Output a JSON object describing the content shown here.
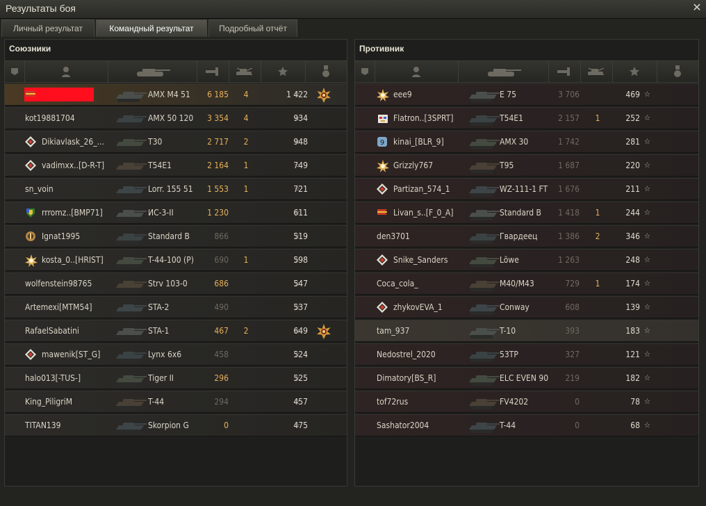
{
  "window": {
    "title": "Результаты боя",
    "close": "✕"
  },
  "tabs": [
    {
      "label": "Личный результат"
    },
    {
      "label": "Командный результат",
      "active": true
    },
    {
      "label": "Подробный отчёт"
    }
  ],
  "allies": {
    "title": "Союзники",
    "rows": [
      {
        "player": "",
        "vehicle": "AMX M4 51",
        "damage": "6 185",
        "kills": "4",
        "xp": "1 422",
        "star": "☆",
        "badge": "flag",
        "medal": true,
        "me": true
      },
      {
        "player": "kot19881704",
        "vehicle": "AMX 50 120",
        "damage": "3 354",
        "kills": "4",
        "xp": "934",
        "star": "☆"
      },
      {
        "player": "Dikiavlask_26_...",
        "vehicle": "T30",
        "damage": "2 717",
        "kills": "2",
        "xp": "948",
        "star": "☆",
        "badge": "diamond"
      },
      {
        "player": "vadimxx..[D-R-T]",
        "vehicle": "T54E1",
        "damage": "2 164",
        "kills": "1",
        "xp": "749",
        "star": "☆",
        "badge": "diamond"
      },
      {
        "player": "sn_voin",
        "vehicle": "Lorr. 155 51",
        "damage": "1 553",
        "kills": "1",
        "xp": "721",
        "star": "☆"
      },
      {
        "player": "rrromz..[BMP71]",
        "vehicle": "ИС-3-II",
        "damage": "1 230",
        "kills": "",
        "xp": "611",
        "star": "☆",
        "badge": "shield"
      },
      {
        "player": "Ignat1995",
        "vehicle": "Standard B",
        "damage": "866",
        "kills": "",
        "xp": "519",
        "star": "☆",
        "badge": "round",
        "dead": true,
        "gray": true
      },
      {
        "player": "kosta_0..[HRIST]",
        "vehicle": "T-44-100 (P)",
        "damage": "690",
        "kills": "1",
        "xp": "598",
        "star": "☆",
        "badge": "sun",
        "dead": true,
        "gray": true
      },
      {
        "player": "wolfenstein98765",
        "vehicle": "Strv 103-0",
        "damage": "686",
        "kills": "",
        "xp": "547",
        "star": "☆"
      },
      {
        "player": "Artemexi[MTM54]",
        "vehicle": "STA-2",
        "damage": "490",
        "kills": "",
        "xp": "537",
        "star": "☆",
        "dead": true,
        "gray": true
      },
      {
        "player": "RafaelSabatini",
        "vehicle": "STA-1",
        "damage": "467",
        "kills": "2",
        "xp": "649",
        "star": "☆",
        "medal": true
      },
      {
        "player": "mawenik[ST_G]",
        "vehicle": "Lynx 6x6",
        "damage": "458",
        "kills": "",
        "xp": "524",
        "star": "☆",
        "badge": "diamond",
        "dead": true,
        "gray": true
      },
      {
        "player": "halo013[-TUS-]",
        "vehicle": "Tiger II",
        "damage": "296",
        "kills": "",
        "xp": "525",
        "star": "☆"
      },
      {
        "player": "King_PiligriM",
        "vehicle": "T-44",
        "damage": "294",
        "kills": "",
        "xp": "457",
        "star": "☆",
        "dead": true,
        "gray": true
      },
      {
        "player": "TITAN139",
        "vehicle": "Skorpion G",
        "damage": "0",
        "kills": "",
        "xp": "475",
        "star": "☆"
      }
    ]
  },
  "enemies": {
    "title": "Противник",
    "rows": [
      {
        "player": "eee9",
        "vehicle": "E 75",
        "damage": "3 706",
        "kills": "",
        "xp": "469",
        "star": "☆",
        "badge": "sun"
      },
      {
        "player": "Flatron..[3SPRT]",
        "vehicle": "T54E1",
        "damage": "2 157",
        "kills": "1",
        "xp": "252",
        "star": "☆",
        "badge": "skull"
      },
      {
        "player": "kinai_[BLR_9]",
        "vehicle": "AMX 30",
        "damage": "1 742",
        "kills": "",
        "xp": "281",
        "star": "☆",
        "badge": "nine"
      },
      {
        "player": "Grizzly767",
        "vehicle": "T95",
        "damage": "1 687",
        "kills": "",
        "xp": "220",
        "star": "☆",
        "badge": "sun"
      },
      {
        "player": "Partizan_574_1",
        "vehicle": "WZ-111-1 FT",
        "damage": "1 676",
        "kills": "",
        "xp": "211",
        "star": "☆",
        "badge": "diamond"
      },
      {
        "player": "Livan_s..[F_0_A]",
        "vehicle": "Standard B",
        "damage": "1 418",
        "kills": "1",
        "xp": "244",
        "star": "☆",
        "badge": "flag"
      },
      {
        "player": "den3701",
        "vehicle": "Гвардеец",
        "damage": "1 386",
        "kills": "2",
        "xp": "346",
        "star": "☆"
      },
      {
        "player": "Snike_Sanders",
        "vehicle": "Löwe",
        "damage": "1 263",
        "kills": "",
        "xp": "248",
        "star": "☆",
        "badge": "diamond"
      },
      {
        "player": "Coca_cola_",
        "vehicle": "M40/M43",
        "damage": "729",
        "kills": "1",
        "xp": "174",
        "star": "☆"
      },
      {
        "player": "zhykovEVA_1",
        "vehicle": "Conway",
        "damage": "608",
        "kills": "",
        "xp": "139",
        "star": "☆",
        "badge": "diamond"
      },
      {
        "player": "tam_937",
        "vehicle": "T-10",
        "damage": "393",
        "kills": "",
        "xp": "183",
        "star": "☆",
        "hl": true
      },
      {
        "player": "Nedostrel_2020",
        "vehicle": "53TP",
        "damage": "327",
        "kills": "",
        "xp": "121",
        "star": "☆"
      },
      {
        "player": "Dimatory[BS_R]",
        "vehicle": "ELC EVEN 90",
        "damage": "219",
        "kills": "",
        "xp": "182",
        "star": "☆"
      },
      {
        "player": "tof72rus",
        "vehicle": "FV4202",
        "damage": "0",
        "kills": "",
        "xp": "78",
        "star": "☆"
      },
      {
        "player": "Sashator2004",
        "vehicle": "T-44",
        "damage": "0",
        "kills": "",
        "xp": "68",
        "star": "☆"
      }
    ]
  },
  "icons": {
    "column_headers": [
      "platoon-icon",
      "player-icon",
      "tank-icon",
      "damage-icon",
      "kills-icon",
      "xp-star-icon",
      "medal-icon"
    ]
  }
}
